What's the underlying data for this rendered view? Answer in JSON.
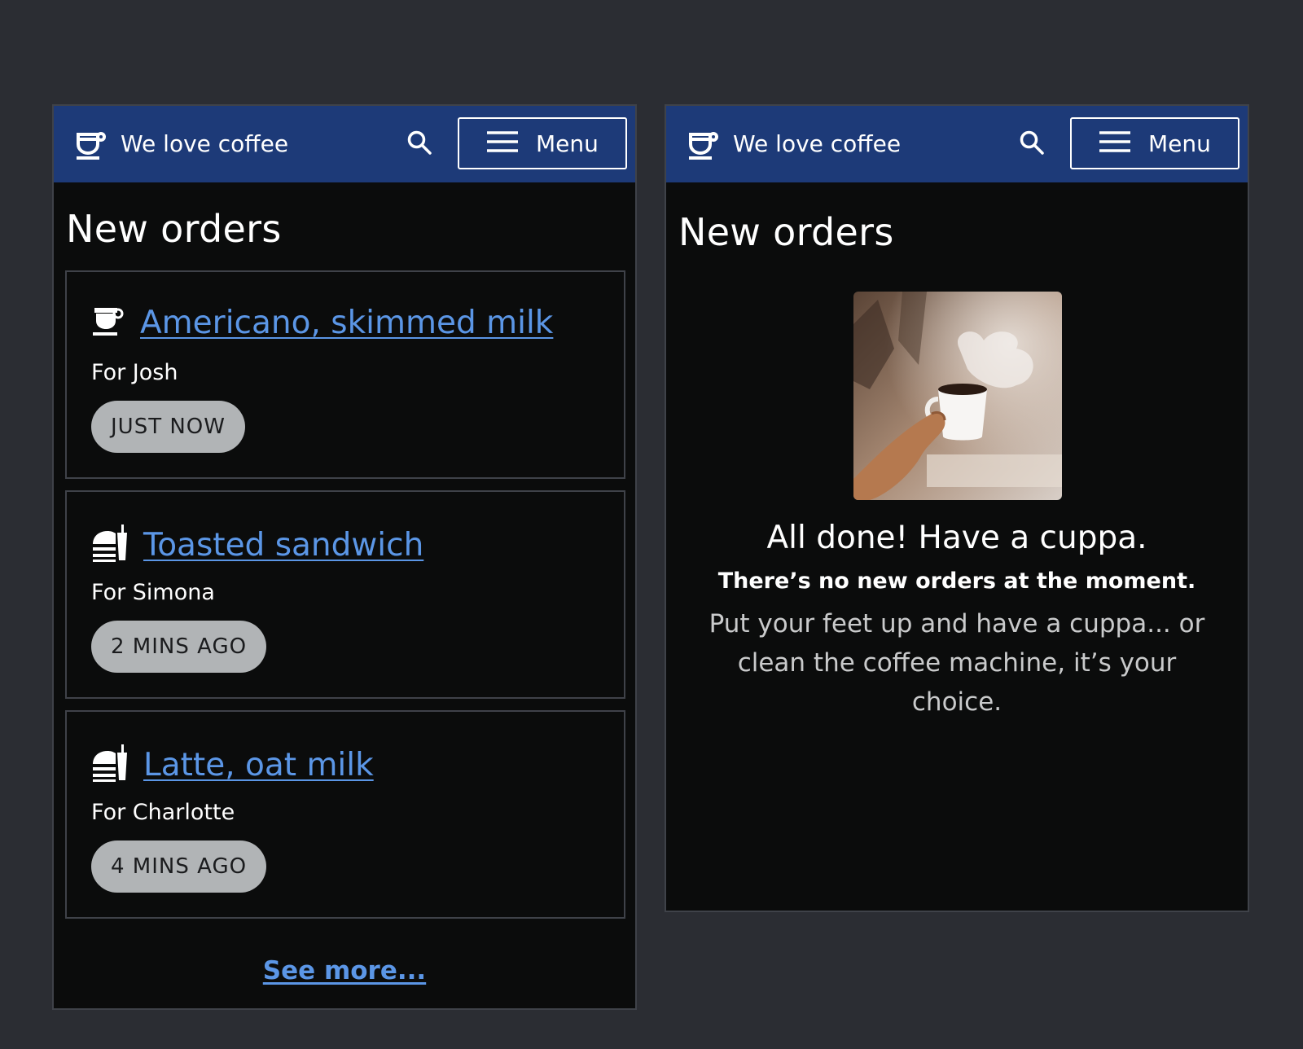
{
  "app": {
    "brand_name": "We love coffee",
    "menu_label": "Menu",
    "icons": {
      "brand": "coffee-cup-icon",
      "search": "search-icon",
      "menu": "hamburger-icon"
    }
  },
  "left_screen": {
    "heading": "New orders",
    "orders": [
      {
        "icon": "coffee-cup-icon",
        "title": "Americano, skimmed milk",
        "customer": "For Josh",
        "time": "JUST NOW"
      },
      {
        "icon": "food-drink-icon",
        "title": "Toasted sandwich",
        "customer": "For Simona",
        "time": "2 MINS AGO"
      },
      {
        "icon": "food-drink-icon",
        "title": "Latte, oat milk",
        "customer": "For Charlotte",
        "time": "4 MINS AGO"
      }
    ],
    "see_more": "See more..."
  },
  "right_screen": {
    "heading": "New orders",
    "empty_state": {
      "title": "All done! Have a cuppa.",
      "subtitle": "There’s no new orders at the moment.",
      "body": "Put your feet up and have a cuppa... or clean the coffee machine, it’s your choice."
    }
  },
  "colors": {
    "page_bg": "#2b2d33",
    "screen_bg": "#0b0c0c",
    "header_bg": "#1d3a78",
    "link": "#5b96e6",
    "pill_bg": "#b1b4b6"
  }
}
